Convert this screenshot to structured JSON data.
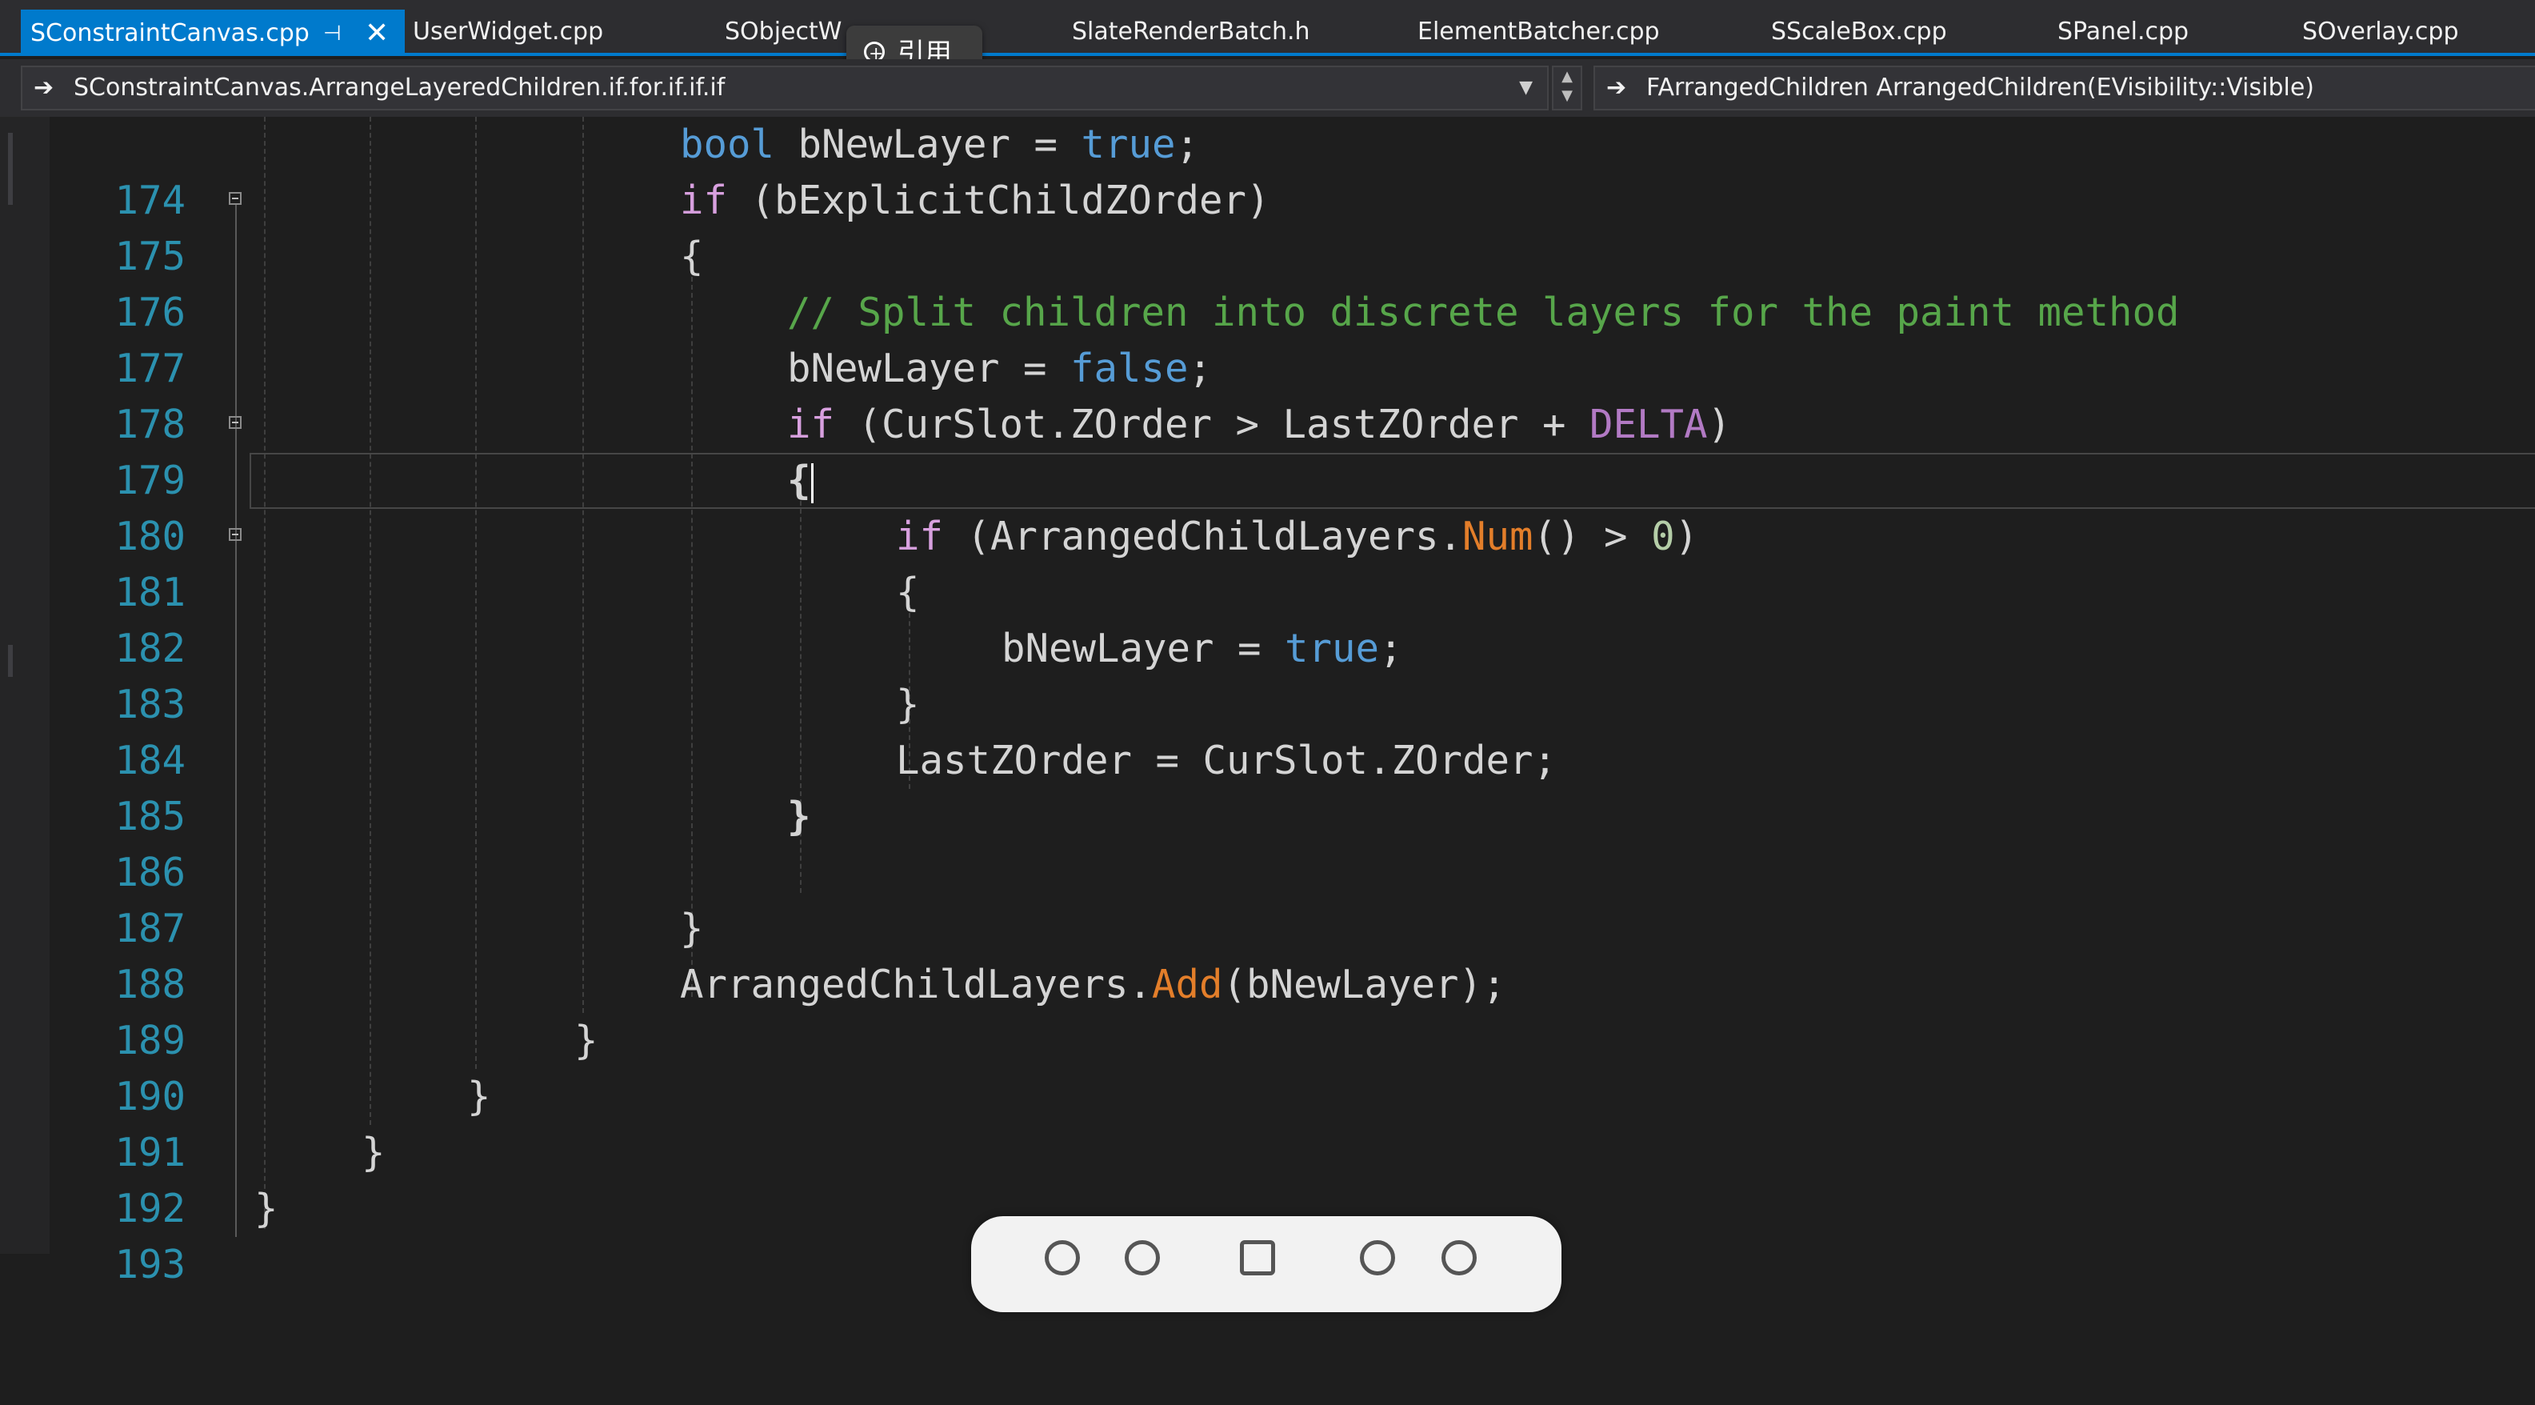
{
  "tabs": [
    {
      "label": "SConstraintCanvas.cpp",
      "active": true
    },
    {
      "label": "UserWidget.cpp"
    },
    {
      "label": "SObjectW"
    },
    {
      "label": "SlateRenderBatch.h"
    },
    {
      "label": "ElementBatcher.cpp"
    },
    {
      "label": "SScaleBox.cpp"
    },
    {
      "label": "SPanel.cpp"
    },
    {
      "label": "SOverlay.cpp"
    }
  ],
  "tab_icons": {
    "pin": "pin-icon",
    "close": "close-icon"
  },
  "tooltip": {
    "icon": "zoom-quote-icon",
    "label": "引用"
  },
  "navigation": {
    "scope": "SConstraintCanvas.ArrangeLayeredChildren.if.for.if.if.if",
    "member": "FArrangedChildren ArrangedChildren(EVisibility::Visible)"
  },
  "editor": {
    "current_line": 180,
    "lines": [
      {
        "num": "174",
        "text": "bool bNewLayer = true;"
      },
      {
        "num": "175",
        "text": "if (bExplicitChildZOrder)"
      },
      {
        "num": "176",
        "text": "{"
      },
      {
        "num": "177",
        "text": "// Split children into discrete layers for the paint method"
      },
      {
        "num": "178",
        "text": "bNewLayer = false;"
      },
      {
        "num": "179",
        "text": "if (CurSlot.ZOrder > LastZOrder + DELTA)"
      },
      {
        "num": "180",
        "text": "{"
      },
      {
        "num": "181",
        "text": "if (ArrangedChildLayers.Num() > 0)"
      },
      {
        "num": "182",
        "text": "{"
      },
      {
        "num": "183",
        "text": "bNewLayer = true;"
      },
      {
        "num": "184",
        "text": "}"
      },
      {
        "num": "185",
        "text": "LastZOrder = CurSlot.ZOrder;"
      },
      {
        "num": "186",
        "text": "}"
      },
      {
        "num": "187",
        "text": ""
      },
      {
        "num": "188",
        "text": "}"
      },
      {
        "num": "189",
        "text": "ArrangedChildLayers.Add(bNewLayer);"
      },
      {
        "num": "190",
        "text": "}"
      },
      {
        "num": "191",
        "text": "}"
      },
      {
        "num": "192",
        "text": "}"
      },
      {
        "num": "193",
        "text": "}"
      }
    ]
  },
  "colors": {
    "accent": "#007acc",
    "keyword": "#569cd6",
    "control": "#d8a0df",
    "comment": "#57a64a",
    "function": "#e37e2a",
    "macro": "#b27ac4",
    "line_number": "#2b91af"
  }
}
